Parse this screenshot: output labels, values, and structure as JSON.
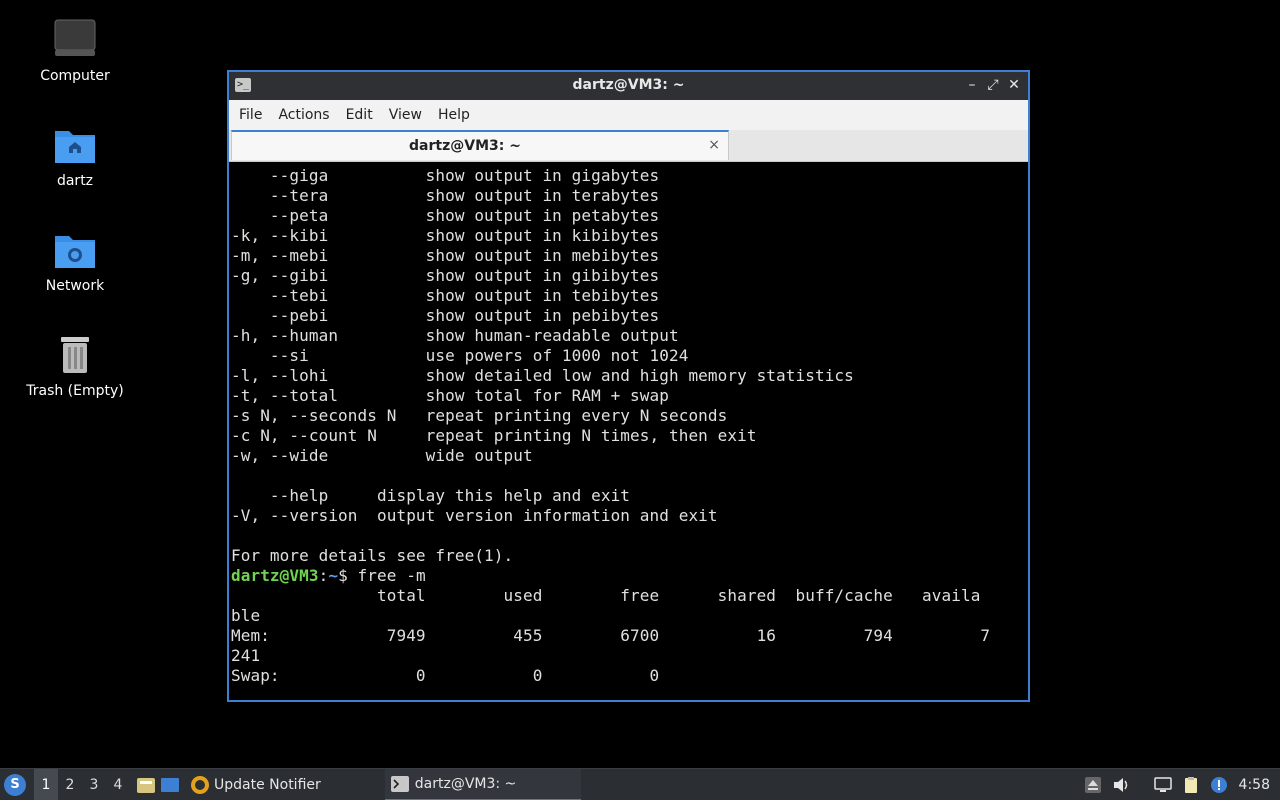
{
  "desktop": {
    "icons": [
      {
        "label": "Computer"
      },
      {
        "label": "dartz"
      },
      {
        "label": "Network"
      },
      {
        "label": "Trash (Empty)"
      }
    ]
  },
  "window": {
    "title": "dartz@VM3: ~",
    "menu": [
      "File",
      "Actions",
      "Edit",
      "View",
      "Help"
    ],
    "tab_label": "dartz@VM3: ~",
    "tab_close": "×",
    "prompt": {
      "user": "dartz@VM3",
      "sep": ":",
      "path": "~",
      "symbol": "$ ",
      "command": "free -m"
    },
    "lines_before": [
      "    --giga          show output in gigabytes",
      "    --tera          show output in terabytes",
      "    --peta          show output in petabytes",
      "-k, --kibi          show output in kibibytes",
      "-m, --mebi          show output in mebibytes",
      "-g, --gibi          show output in gibibytes",
      "    --tebi          show output in tebibytes",
      "    --pebi          show output in pebibytes",
      "-h, --human         show human-readable output",
      "    --si            use powers of 1000 not 1024",
      "-l, --lohi          show detailed low and high memory statistics",
      "-t, --total         show total for RAM + swap",
      "-s N, --seconds N   repeat printing every N seconds",
      "-c N, --count N     repeat printing N times, then exit",
      "-w, --wide          wide output",
      "",
      "    --help     display this help and exit",
      "-V, --version  output version information and exit",
      "",
      "For more details see free(1)."
    ],
    "lines_after": [
      "               total        used        free      shared  buff/cache   availa",
      "ble",
      "Mem:            7949         455        6700          16         794         7",
      "241",
      "Swap:              0           0           0"
    ]
  },
  "taskbar": {
    "workspaces": [
      "1",
      "2",
      "3",
      "4"
    ],
    "tasks": [
      {
        "label": "Update Notifier"
      },
      {
        "label": "dartz@VM3: ~"
      }
    ],
    "clock": "4:58"
  },
  "colors": {
    "accent": "#3d7fd3",
    "prompt_user": "#6fd44f",
    "prompt_path": "#5a9cf2"
  }
}
